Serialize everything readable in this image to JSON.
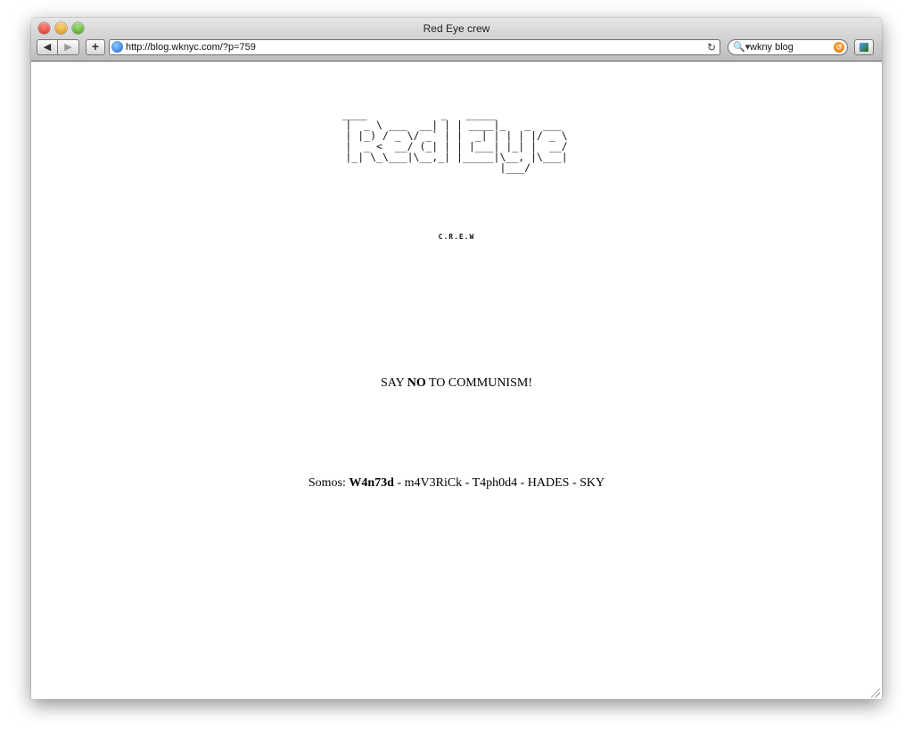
{
  "window": {
    "title": "Red Eye crew"
  },
  "toolbar": {
    "back_label": "◀",
    "forward_label": "▶",
    "add_label": "+",
    "url": "http://blog.wknyc.com/?p=759",
    "reload_label": "↻",
    "search_value": "wkny blog",
    "search_icon": "🔍▾",
    "search_clear_label": "↺"
  },
  "page": {
    "ascii_logo": " ____            _   _____             \n|  _ \\ ___  __| | | ____|_   _  ___ \n| |_) / _ \\/ _` | |  _| | | | |/ _ \\\n|  _ <  __/ (_| | | |___| |_| |  __/\n|_| \\_\\___|\\__,_| |_____|\\__, |\\___|\n                         |___/      ",
    "crew": "C.R.E.W",
    "slogan_prefix": "SAY ",
    "slogan_bold": "NO",
    "slogan_suffix": " TO COMMUNISM!",
    "members_prefix": "Somos: ",
    "members_bold": "W4n73d",
    "members_rest": " - m4V3RiCk - T4ph0d4 - HADES - SKY"
  }
}
